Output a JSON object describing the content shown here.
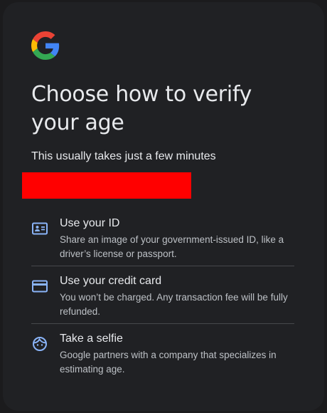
{
  "heading": {
    "title": "Choose how to verify your age",
    "subtitle": "This usually takes just a few minutes"
  },
  "options": [
    {
      "icon": "id-card-icon",
      "title": "Use your ID",
      "description": "Share an image of your government-issued ID, like a driver’s license or passport."
    },
    {
      "icon": "credit-card-icon",
      "title": "Use your credit card",
      "description": "You won’t be charged. Any transaction fee will be fully refunded."
    },
    {
      "icon": "face-icon",
      "title": "Take a selfie",
      "description": "Google partners with a company that specializes in estimating age."
    }
  ],
  "colors": {
    "accent": "#8ab4f8",
    "background": "#202124",
    "redaction": "#ff0000"
  }
}
